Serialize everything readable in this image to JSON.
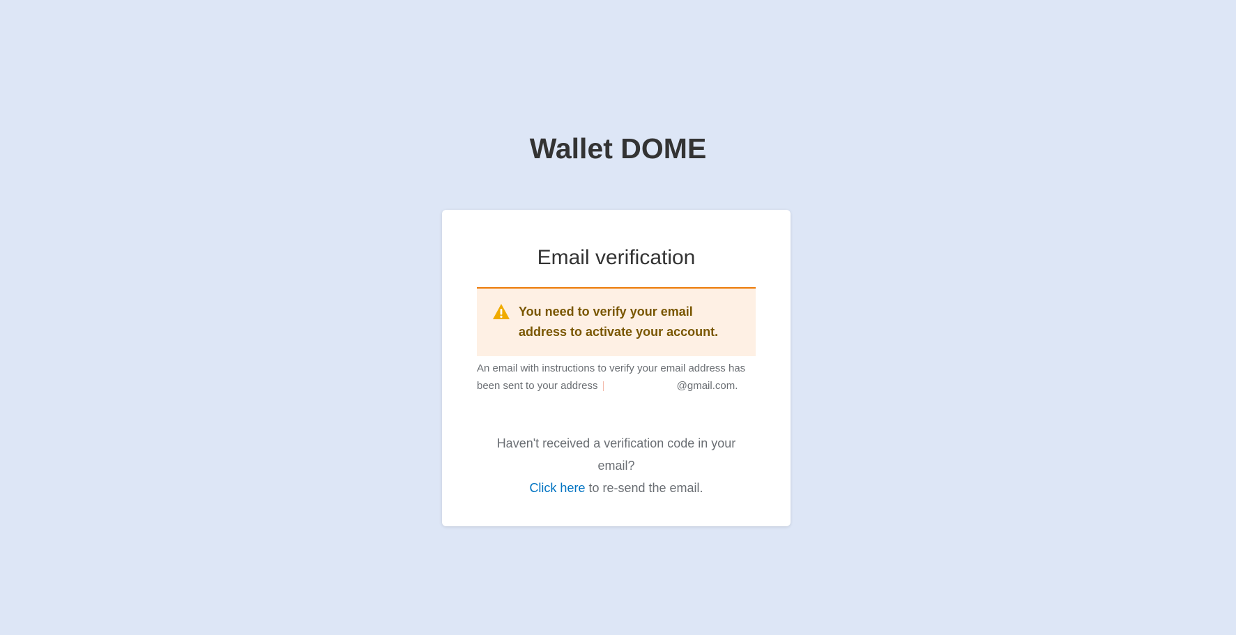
{
  "brand": {
    "title": "Wallet DOME"
  },
  "card": {
    "title": "Email verification",
    "alert": {
      "icon": "warning-triangle-icon",
      "icon_color": "#f0ab00",
      "message": "You need to verify your email address to activate your account."
    },
    "info": {
      "text_prefix": "An email with instructions to verify your email address has been sent to your address",
      "email_suffix": "@gmail.com."
    },
    "resend": {
      "question": "Haven't received a verification code in your email?",
      "link_label": "Click here",
      "link_suffix": " to re-send the email."
    }
  },
  "colors": {
    "background": "#dde6f6",
    "alert_border": "#ec7a08",
    "alert_background": "#fef0e4",
    "alert_text": "#795600",
    "link": "#0073c2"
  }
}
